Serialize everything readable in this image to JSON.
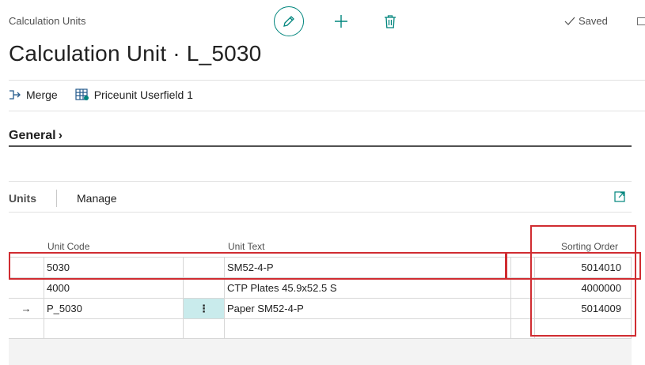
{
  "breadcrumb": "Calculation Units",
  "status": {
    "saved_label": "Saved"
  },
  "title": "Calculation Unit · L_5030",
  "actions": [
    {
      "label": "Merge",
      "icon": "merge-icon"
    },
    {
      "label": "Priceunit Userfield 1",
      "icon": "table-icon"
    }
  ],
  "general": {
    "label": "General"
  },
  "units": {
    "tab_label": "Units",
    "manage_label": "Manage",
    "columns": {
      "unit_code": "Unit Code",
      "unit_text": "Unit Text",
      "sorting_order": "Sorting Order"
    },
    "rows": [
      {
        "marker": "",
        "unit_code": "5030",
        "unit_text": "SM52-4-P",
        "sorting_order": "5014010"
      },
      {
        "marker": "",
        "unit_code": "4000",
        "unit_text": "CTP Plates 45.9x52.5 S",
        "sorting_order": "4000000"
      },
      {
        "marker": "→",
        "unit_code": "P_5030",
        "unit_text": "Paper SM52-4-P",
        "sorting_order": "5014009",
        "menu": "⋮"
      },
      {
        "marker": "",
        "unit_code": "",
        "unit_text": "",
        "sorting_order": ""
      }
    ]
  },
  "colors": {
    "accent": "#00857d",
    "highlight": "#d02c31",
    "selected_cell": "#c9ebec"
  }
}
